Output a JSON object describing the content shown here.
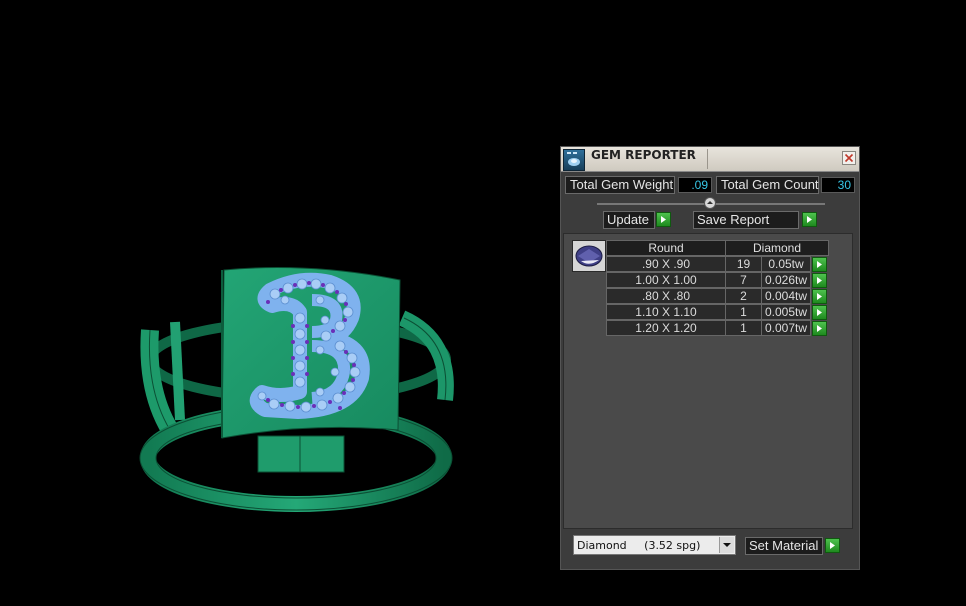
{
  "panel": {
    "title": "GEM REPORTER",
    "total_gem_weight_label": "Total Gem Weight",
    "total_gem_weight_value": ".09",
    "total_gem_count_label": "Total Gem Count",
    "total_gem_count_value": "30",
    "update_label": "Update",
    "save_report_label": "Save Report",
    "table": {
      "headers": [
        "Round",
        "Diamond"
      ],
      "rows": [
        {
          "size": ".90 X .90",
          "count": "19",
          "weight": "0.05tw"
        },
        {
          "size": "1.00 X 1.00",
          "count": "7",
          "weight": "0.026tw"
        },
        {
          "size": ".80 X .80",
          "count": "2",
          "weight": "0.004tw"
        },
        {
          "size": "1.10 X 1.10",
          "count": "1",
          "weight": "0.005tw"
        },
        {
          "size": "1.20 X 1.20",
          "count": "1",
          "weight": "0.007tw"
        }
      ]
    },
    "material_select_value": "Diamond     (3.52 spg)",
    "set_material_label": "Set Material"
  },
  "colors": {
    "ring_green": "#1f9a6a",
    "ring_green_dark": "#0d5a3c",
    "gem_blue": "#7fb2ee",
    "prong_purple": "#6a2fb8",
    "value_cyan": "#37c6e6",
    "button_green": "#2e9e2e"
  },
  "icons": {
    "app": "gem-reporter-app-icon",
    "close": "close-icon",
    "play": "play-arrow-icon",
    "gem": "round-gem-icon",
    "dropdown": "chevron-down-icon"
  }
}
